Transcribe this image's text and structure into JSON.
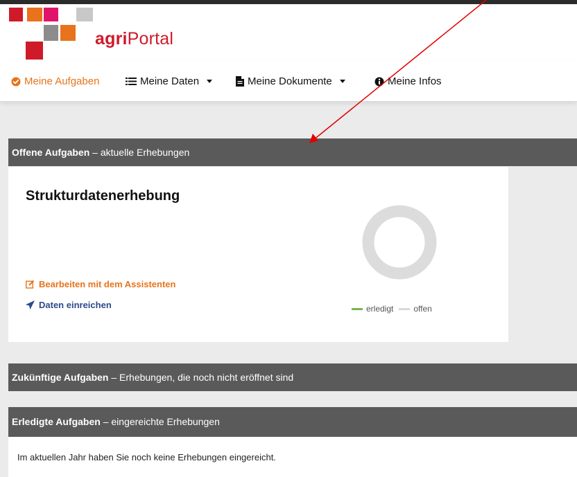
{
  "brand": {
    "prefix": "agri",
    "suffix": "Portal"
  },
  "nav": {
    "items": [
      {
        "label": "Meine Aufgaben",
        "icon": "check-circle-icon",
        "active": true
      },
      {
        "label": "Meine Daten",
        "icon": "list-icon",
        "dropdown": true
      },
      {
        "label": "Meine Dokumente",
        "icon": "document-icon",
        "dropdown": true
      },
      {
        "label": "Meine Infos",
        "icon": "info-circle-icon"
      }
    ]
  },
  "sections": {
    "open": {
      "title": "Offene Aufgaben",
      "subtitle": "– aktuelle Erhebungen"
    },
    "future": {
      "title": "Zukünftige Aufgaben",
      "subtitle": "– Erhebungen, die noch nicht eröffnet sind"
    },
    "done": {
      "title": "Erledigte Aufgaben",
      "subtitle": "– eingereichte Erhebungen"
    }
  },
  "task_card": {
    "title": "Strukturdatenerhebung",
    "edit_link": "Bearbeiten mit dem Assistenten",
    "submit_link": "Daten einreichen",
    "progress": {
      "erledigt": 0,
      "offen": 1
    },
    "legend": {
      "done": "erledigt",
      "open": "offen"
    }
  },
  "done_info": "Im aktuellen Jahr haben Sie noch keine Erhebungen eingereicht.",
  "colors": {
    "accent": "#e8731c",
    "link_blue": "#2c4a8a",
    "panel_header": "#5a5a5a",
    "brand_red": "#cf1a2a",
    "legend_done": "#7ab648",
    "legend_open": "#d8d8d8",
    "annotation_arrow": "#e00000"
  }
}
